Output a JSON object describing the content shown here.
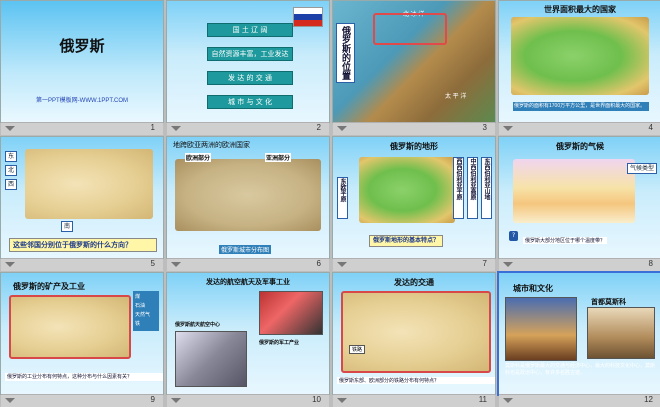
{
  "slides": [
    {
      "num": "1",
      "title": "俄罗斯",
      "footer": "第一PPT模板网-WWW.1PPT.COM"
    },
    {
      "num": "2",
      "menu": [
        "国  土  辽  阔",
        "自然资源丰富，工业发达",
        "发  达  的  交  通",
        "城  市  与  文  化"
      ]
    },
    {
      "num": "3",
      "vtitle": "俄罗斯的位置",
      "ocean1": "北 冰 洋",
      "ocean2": "太 平 洋"
    },
    {
      "num": "4",
      "title": "世界面积最大的国家",
      "caption": "俄罗斯的面积有1700万平方公里，是世界面积最大的国家。"
    },
    {
      "num": "5",
      "tags": [
        "东",
        "北",
        "西",
        "南"
      ],
      "question": "这些邻国分别位于俄罗斯的什么方向？"
    },
    {
      "num": "6",
      "title": "地跨欧亚两洲的欧洲国家",
      "left": "欧洲部分",
      "right": "亚洲部分",
      "caption": "俄罗斯城市分布图"
    },
    {
      "num": "7",
      "title": "俄罗斯的地形",
      "labels": [
        "东欧平原",
        "西西伯利亚平原",
        "中西伯利亚高原",
        "东西伯利亚山地"
      ],
      "question": "俄罗斯地形的基本特点？"
    },
    {
      "num": "8",
      "title": "俄罗斯的气候",
      "tag": "气候类型",
      "question": "俄罗斯大部分地区位于哪个温度带？"
    },
    {
      "num": "9",
      "title": "俄罗斯的矿产及工业",
      "legend": [
        "煤",
        "石油",
        "天然气",
        "铁"
      ],
      "question": "俄罗斯的工业分布有何特点，这种分布与什么因素有关？"
    },
    {
      "num": "10",
      "title": "发达的航空航天及军事工业",
      "caption1": "俄罗斯航天航空中心",
      "caption2": "俄罗斯的军工产业"
    },
    {
      "num": "11",
      "title": "发达的交通",
      "legend": "铁路",
      "question": "俄罗斯东部、欧洲部分的铁路分布有何特点？"
    },
    {
      "num": "12",
      "title": "城市和文化",
      "subtitle": "首都莫斯科",
      "caption": "莫斯科是俄罗斯最大的交通与经济中心，最大的科技文化中心，莫斯科也是政治中心，有许多名胜古迹。"
    }
  ],
  "colors": {
    "selection": "#3a6fd8",
    "menu": "#1e9a9e",
    "question": "#1f3a8a"
  }
}
